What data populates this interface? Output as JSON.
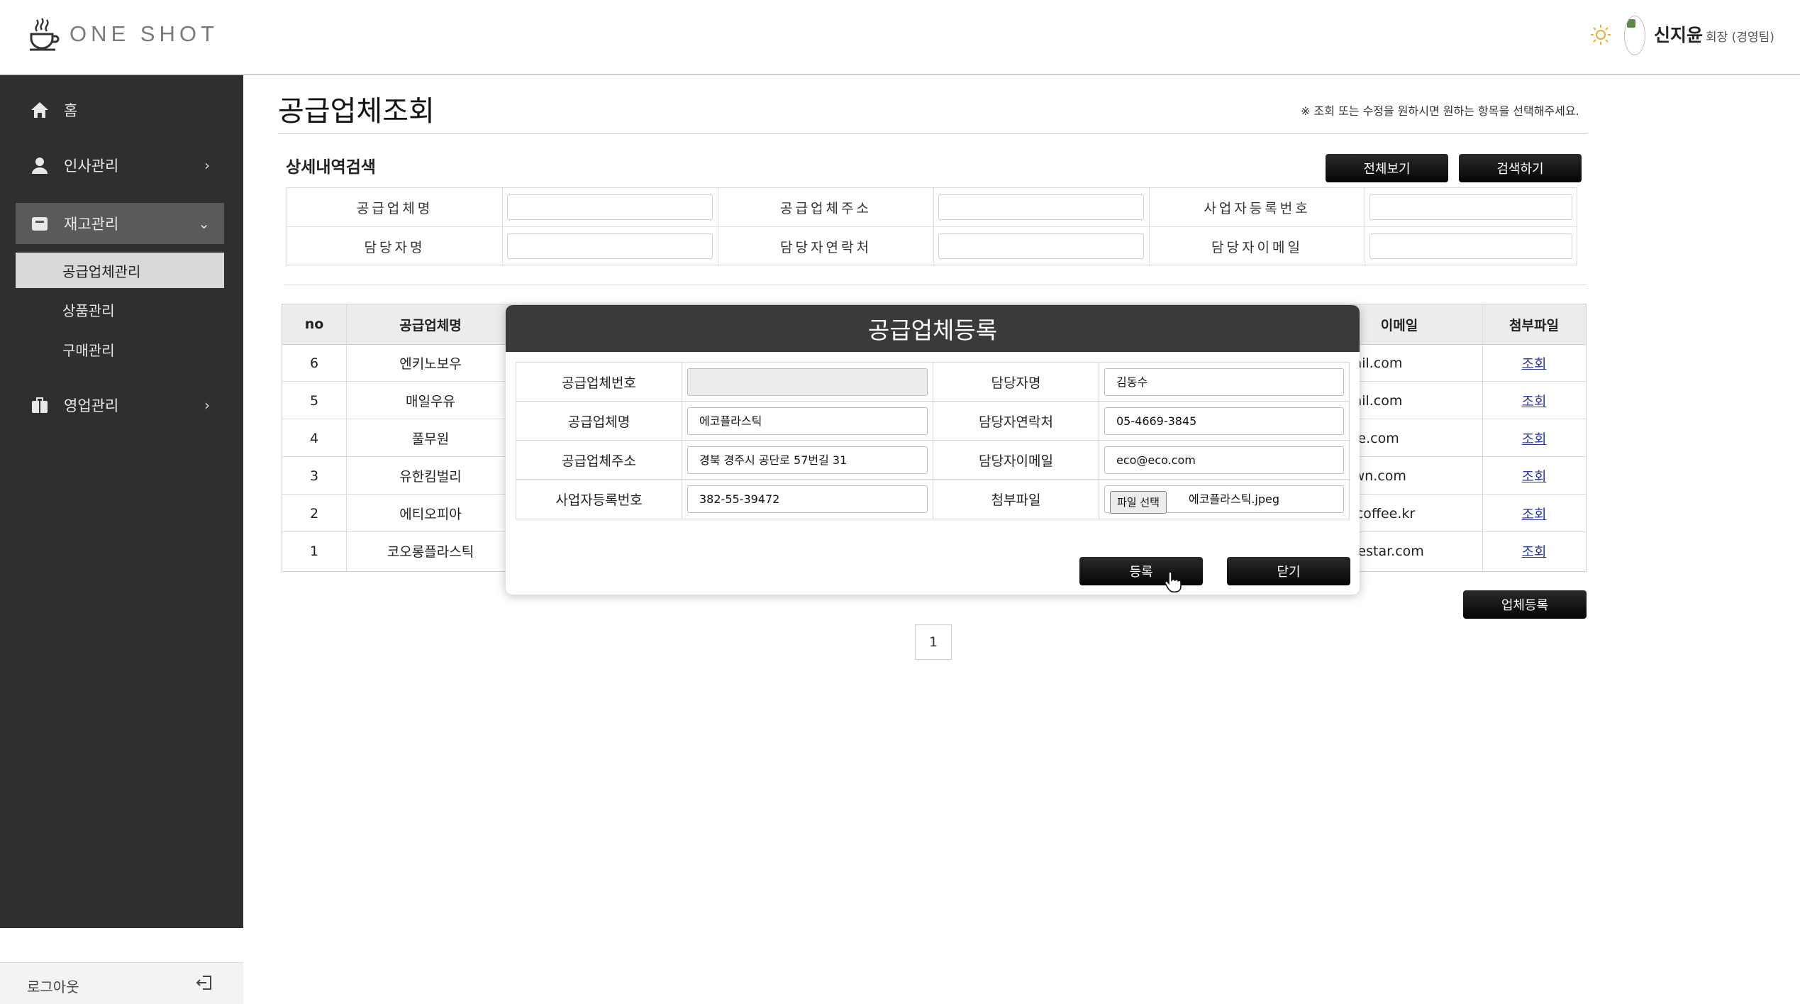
{
  "header": {
    "logo_text": "ONE SHOT",
    "user_name": "신지윤",
    "user_role": "회장 (경영팀)"
  },
  "sidebar": {
    "items": [
      {
        "label": "홈",
        "icon": "home-icon"
      },
      {
        "label": "인사관리",
        "icon": "person-icon"
      },
      {
        "label": "재고관리",
        "icon": "box-icon"
      },
      {
        "label": "영업관리",
        "icon": "briefcase-icon"
      }
    ],
    "sub_items": [
      "공급업체관리",
      "상품관리",
      "구매관리"
    ],
    "logout": "로그아웃"
  },
  "page": {
    "title": "공급업체조회",
    "notice": "※ 조회 또는 수정을 원하시면 원하는 항목을 선택해주세요."
  },
  "search": {
    "title": "상세내역검색",
    "view_all": "전체보기",
    "search_button": "검색하기",
    "fields": [
      "공급업체명",
      "공급업체주소",
      "사업자등록번호",
      "담당자명",
      "담당자연락처",
      "담당자이메일"
    ]
  },
  "table": {
    "headers": [
      "no",
      "공급업체명",
      "이메일",
      "첨부파일"
    ],
    "rows": [
      {
        "no": "6",
        "name": "엔키노보우",
        "email": "gmail.com",
        "file": "조회"
      },
      {
        "no": "5",
        "name": "매일우유",
        "email": "gmail.com",
        "file": "조회"
      },
      {
        "no": "4",
        "name": "풀무원",
        "email": "offee.com",
        "file": "조회"
      },
      {
        "no": "3",
        "name": "유한킴벌리",
        "email": "orown.com",
        "file": "조회"
      },
      {
        "no": "2",
        "name": "에티오피아",
        "email": "acecoffee.kr",
        "file": "조회"
      },
      {
        "no": "1",
        "name": "코오롱플라스틱",
        "email": "offeestar.com",
        "file": "조회"
      }
    ],
    "register_button": "업체등록",
    "page": "1"
  },
  "modal": {
    "title": "공급업체등록",
    "labels": {
      "supplier_no": "공급업체번호",
      "supplier_name": "공급업체명",
      "supplier_address": "공급업체주소",
      "business_no": "사업자등록번호",
      "manager_name": "담당자명",
      "manager_phone": "담당자연락처",
      "manager_email": "담당자이메일",
      "attachment": "첨부파일"
    },
    "values": {
      "supplier_no": "",
      "supplier_name": "에코플라스틱",
      "supplier_address": "경북 경주시 공단로 57번길 31",
      "business_no": "382-55-39472",
      "manager_name": "김동수",
      "manager_phone": "05-4669-3845",
      "manager_email": "eco@eco.com",
      "file_button": "파일 선택",
      "file_name": "에코플라스틱.jpeg"
    },
    "submit": "등록",
    "close": "닫기"
  },
  "colors": {
    "sidebar_bg": "#2f2f2f",
    "active_bg": "#5a5a5a",
    "modal_header": "#3a3a3a",
    "link": "#2b3aa8"
  }
}
